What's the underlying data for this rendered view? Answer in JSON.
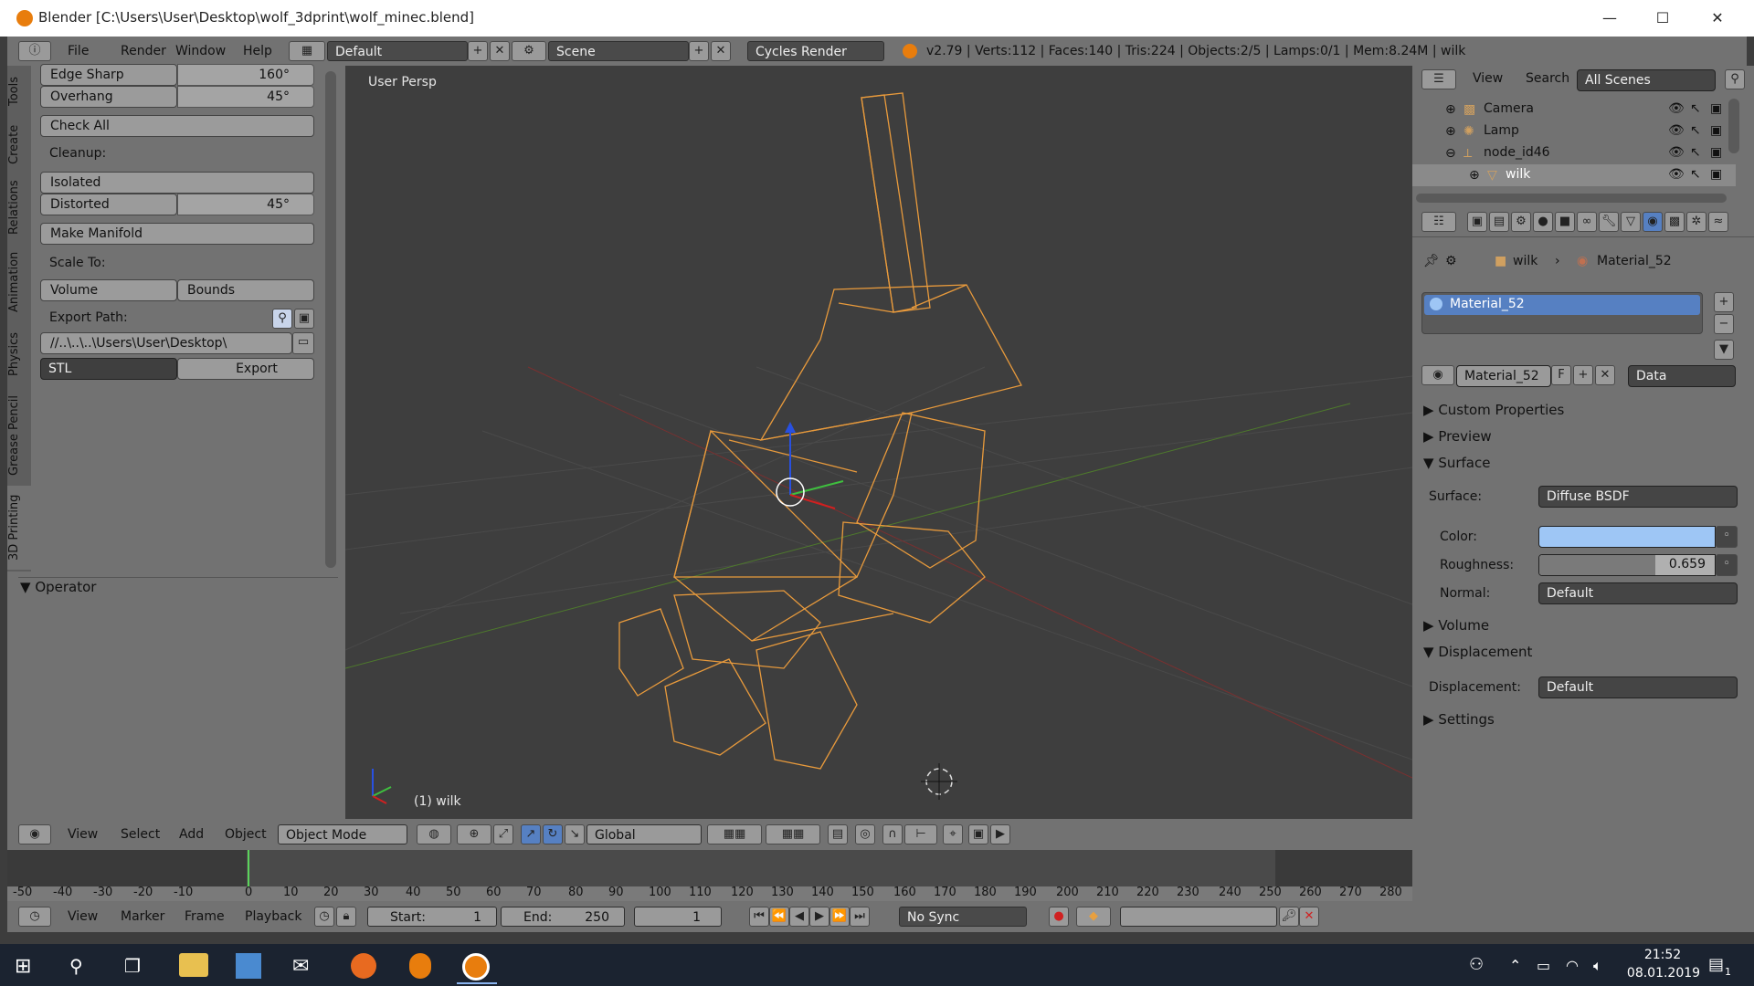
{
  "window": {
    "title": "Blender [C:\\Users\\User\\Desktop\\wolf_3dprint\\wolf_minec.blend]",
    "min": "—",
    "max": "☐",
    "close": "✕"
  },
  "info_header": {
    "menus": [
      "File",
      "Render",
      "Window",
      "Help"
    ],
    "layout": "Default",
    "scene": "Scene",
    "engine": "Cycles Render",
    "stats": "v2.79 | Verts:112 | Faces:140 | Tris:224 | Objects:2/5 | Lamps:0/1 | Mem:8.24M | wilk"
  },
  "toolshelf": {
    "tabs": [
      "Tools",
      "Create",
      "Relations",
      "Animation",
      "Physics",
      "Grease Pencil",
      "3D Printing"
    ],
    "edge_sharp_label": "Edge Sharp",
    "edge_sharp_value": "160°",
    "overhang_label": "Overhang",
    "overhang_value": "45°",
    "check_all": "Check All",
    "cleanup": "Cleanup:",
    "isolated": "Isolated",
    "distorted_label": "Distorted",
    "distorted_value": "45°",
    "make_manifold": "Make Manifold",
    "scale_to": "Scale To:",
    "volume": "Volume",
    "bounds": "Bounds",
    "export_path_label": "Export Path:",
    "export_path_value": "//..\\..\\..\\Users\\User\\Desktop\\",
    "format": "STL",
    "export": "Export",
    "operator": "Operator"
  },
  "viewport": {
    "view_name": "User Persp",
    "object_label": "(1) wilk"
  },
  "view_header": {
    "menus": [
      "View",
      "Select",
      "Add",
      "Object"
    ],
    "mode": "Object Mode",
    "orientation": "Global"
  },
  "timeline": {
    "ticks": [
      "-50",
      "-40",
      "-30",
      "-20",
      "-10",
      "0",
      "10",
      "20",
      "30",
      "40",
      "50",
      "60",
      "70",
      "80",
      "90",
      "100",
      "110",
      "120",
      "130",
      "140",
      "150",
      "160",
      "170",
      "180",
      "190",
      "200",
      "210",
      "220",
      "230",
      "240",
      "250",
      "260",
      "270",
      "280"
    ],
    "menus": [
      "View",
      "Marker",
      "Frame",
      "Playback"
    ],
    "start_label": "Start:",
    "start_value": "1",
    "end_label": "End:",
    "end_value": "250",
    "current": "1",
    "sync": "No Sync"
  },
  "outliner": {
    "menus": [
      "View",
      "Search"
    ],
    "filter": "All Scenes",
    "items": [
      {
        "name": "Camera"
      },
      {
        "name": "Lamp"
      },
      {
        "name": "node_id46"
      },
      {
        "name": "wilk"
      }
    ]
  },
  "properties": {
    "breadcrumb_object": "wilk",
    "breadcrumb_material": "Material_52",
    "slot_name": "Material_52",
    "material_name": "Material_52",
    "fake_user": "F",
    "link": "Data",
    "panels": {
      "custom_properties": "Custom Properties",
      "preview": "Preview",
      "surface": "Surface",
      "volume": "Volume",
      "displacement": "Displacement",
      "settings": "Settings"
    },
    "surface_label": "Surface:",
    "surface_value": "Diffuse BSDF",
    "color_label": "Color:",
    "color_hex": "#9ec6f5",
    "roughness_label": "Roughness:",
    "roughness_value": "0.659",
    "roughness_fraction": 0.659,
    "normal_label": "Normal:",
    "normal_value": "Default",
    "displacement_label": "Displacement:",
    "displacement_value": "Default"
  },
  "taskbar": {
    "time": "21:52",
    "date": "08.01.2019",
    "notif": "1"
  }
}
